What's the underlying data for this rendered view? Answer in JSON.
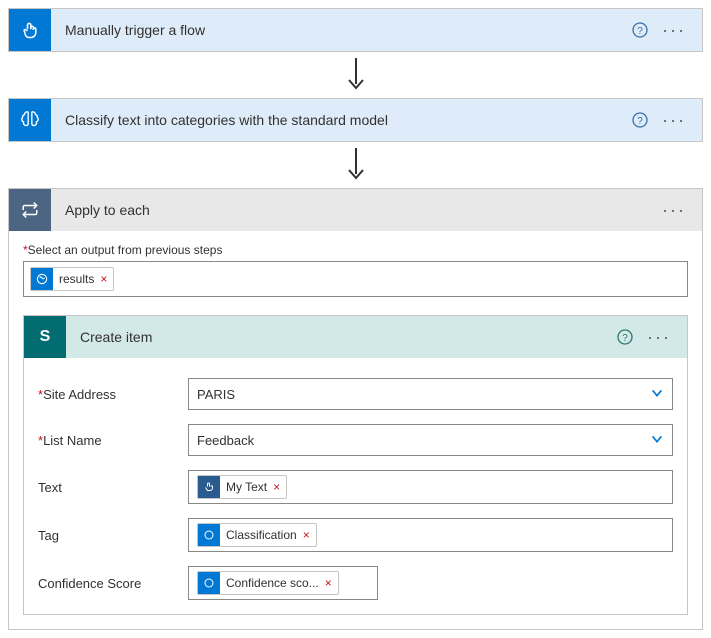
{
  "trigger": {
    "title": "Manually trigger a flow"
  },
  "action1": {
    "title": "Classify text into categories with the standard model"
  },
  "apply_to_each": {
    "title": "Apply to each",
    "select_label": "Select an output from previous steps",
    "token_label": "results"
  },
  "create_item": {
    "title": "Create item",
    "fields": {
      "site_address": {
        "label": "Site Address",
        "value": "PARIS"
      },
      "list_name": {
        "label": "List Name",
        "value": "Feedback"
      },
      "text": {
        "label": "Text",
        "token": "My Text"
      },
      "tag": {
        "label": "Tag",
        "token": "Classification"
      },
      "confidence": {
        "label": "Confidence Score",
        "token": "Confidence sco..."
      }
    }
  }
}
